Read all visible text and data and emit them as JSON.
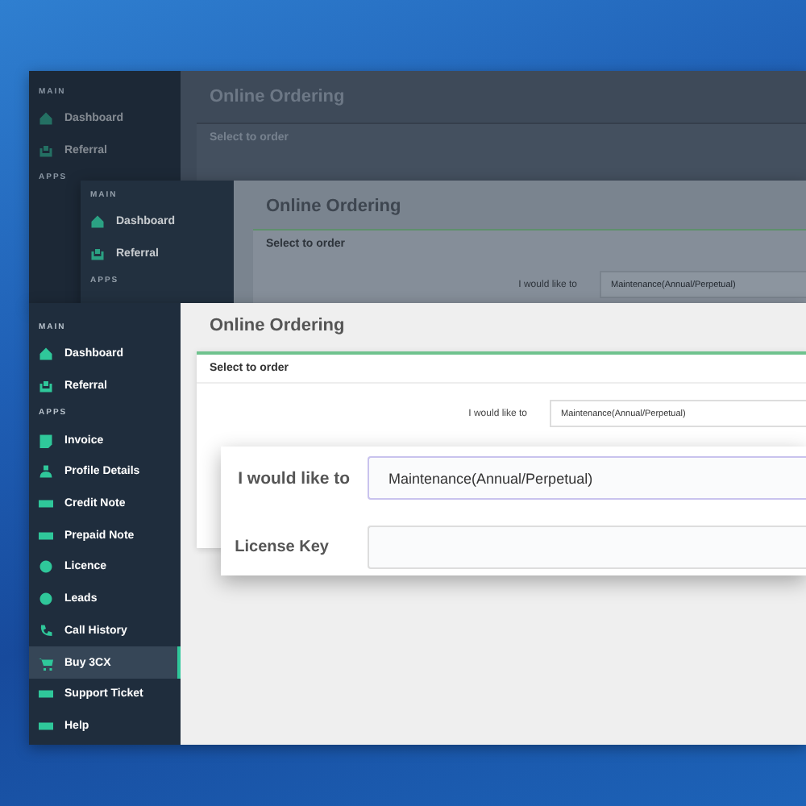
{
  "layers": [
    {
      "sidebar": [
        {
          "title": "MAIN",
          "items": [
            {
              "label": "Dashboard",
              "selected": false
            },
            {
              "label": "Referral",
              "selected": false
            }
          ]
        },
        {
          "title": "APPS"
        }
      ],
      "page_title": "Online Ordering",
      "card_title": "Select to order"
    },
    {
      "sidebar": [
        {
          "title": "MAIN",
          "items": [
            {
              "label": "Dashboard",
              "selected": false
            },
            {
              "label": "Referral",
              "selected": false
            }
          ]
        },
        {
          "title": "APPS"
        }
      ],
      "page_title": "Online Ordering",
      "card_title": "Select to order",
      "rows": [
        {
          "label": "I would like to",
          "value": "Maintenance(Annual/Perpetual)"
        }
      ]
    },
    {
      "sidebar": [
        {
          "title": "MAIN",
          "items": [
            {
              "label": "Dashboard",
              "selected": false
            },
            {
              "label": "Referral",
              "selected": false
            }
          ]
        },
        {
          "title": "APPS",
          "items": [
            {
              "label": "Invoice",
              "selected": false
            },
            {
              "label": "Profile Details",
              "selected": false
            },
            {
              "label": "Credit Note",
              "selected": false
            },
            {
              "label": "Prepaid Note",
              "selected": false
            },
            {
              "label": "Licence",
              "selected": false
            },
            {
              "label": "Leads",
              "selected": false
            },
            {
              "label": "Call History",
              "selected": false
            },
            {
              "label": "Buy 3CX",
              "selected": true
            },
            {
              "label": "Support Ticket",
              "selected": false
            },
            {
              "label": "Help",
              "selected": false
            }
          ]
        }
      ],
      "page_title": "Online Ordering",
      "card_title": "Select to order",
      "rows": [
        {
          "label": "I would like to",
          "value": "Maintenance(Annual/Perpetual)"
        }
      ]
    }
  ],
  "zoom_panel": {
    "rows": [
      {
        "label": "I would like to",
        "value": "Maintenance(Annual/Perpetual)"
      },
      {
        "label": "License Key"
      }
    ]
  }
}
